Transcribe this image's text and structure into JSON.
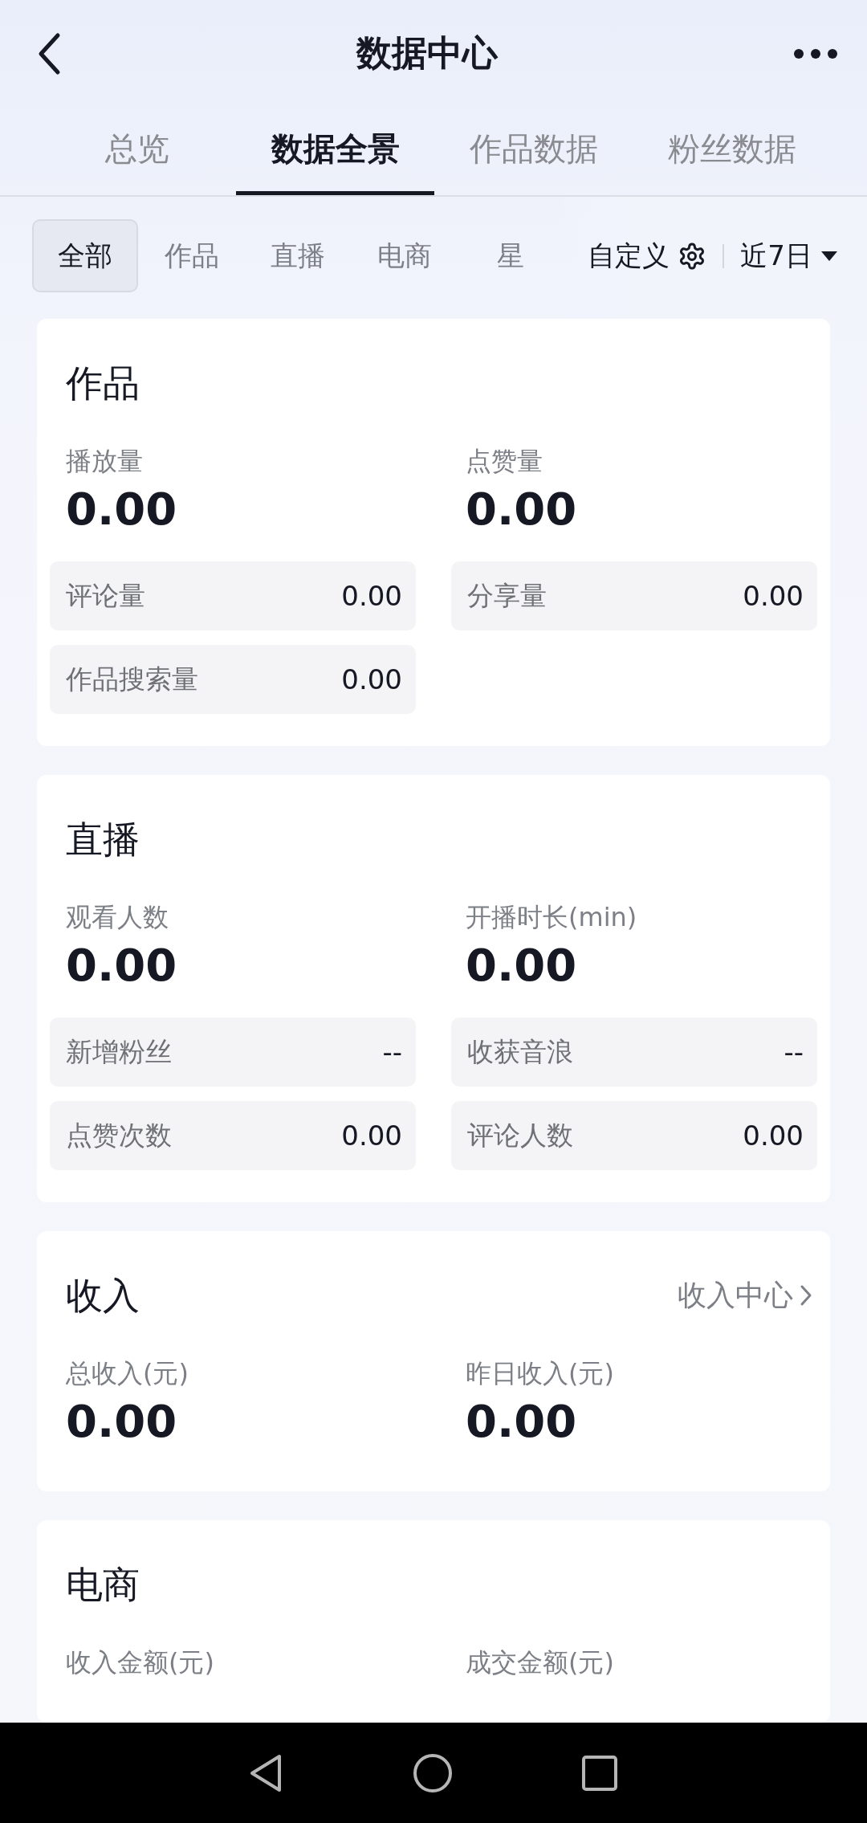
{
  "header": {
    "title": "数据中心"
  },
  "tabs": [
    {
      "label": "总览",
      "selected": false
    },
    {
      "label": "数据全景",
      "selected": true
    },
    {
      "label": "作品数据",
      "selected": false
    },
    {
      "label": "粉丝数据",
      "selected": false
    }
  ],
  "filters": [
    {
      "label": "全部",
      "selected": true
    },
    {
      "label": "作品",
      "selected": false
    },
    {
      "label": "直播",
      "selected": false
    },
    {
      "label": "电商",
      "selected": false
    },
    {
      "label": "星",
      "selected": false
    }
  ],
  "customize": {
    "label": "自定义"
  },
  "period": {
    "label": "近7日"
  },
  "sections": [
    {
      "title": "作品",
      "metrics": [
        {
          "label": "播放量",
          "value": "0.00"
        },
        {
          "label": "点赞量",
          "value": "0.00"
        }
      ],
      "tiles": [
        {
          "label": "评论量",
          "value": "0.00"
        },
        {
          "label": "分享量",
          "value": "0.00"
        },
        {
          "label": "作品搜索量",
          "value": "0.00"
        }
      ]
    },
    {
      "title": "直播",
      "metrics": [
        {
          "label": "观看人数",
          "value": "0.00"
        },
        {
          "label": "开播时长(min)",
          "value": "0.00"
        }
      ],
      "tiles": [
        {
          "label": "新增粉丝",
          "value": "--"
        },
        {
          "label": "收获音浪",
          "value": "--"
        },
        {
          "label": "点赞次数",
          "value": "0.00"
        },
        {
          "label": "评论人数",
          "value": "0.00"
        }
      ]
    },
    {
      "title": "收入",
      "link": "收入中心",
      "metrics": [
        {
          "label": "总收入(元)",
          "value": "0.00"
        },
        {
          "label": "昨日收入(元)",
          "value": "0.00"
        }
      ]
    },
    {
      "title": "电商",
      "metrics": [
        {
          "label": "收入金额(元)"
        },
        {
          "label": "成交金额(元)"
        }
      ]
    }
  ]
}
